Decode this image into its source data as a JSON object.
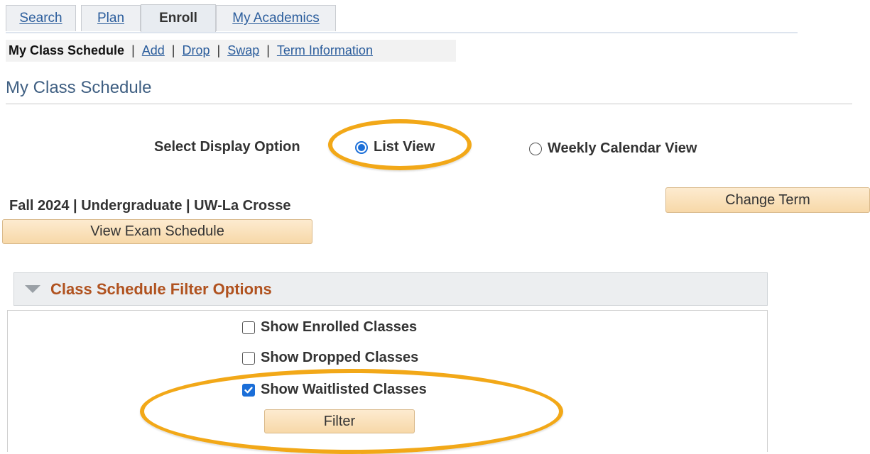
{
  "tabs": [
    {
      "label": "Search"
    },
    {
      "label": "Plan"
    },
    {
      "label": "Enroll"
    },
    {
      "label": "My Academics"
    }
  ],
  "subnav": {
    "current": "My Class Schedule",
    "links": [
      "Add",
      "Drop",
      "Swap",
      "Term Information"
    ]
  },
  "page_title": "My Class Schedule",
  "display_option": {
    "label": "Select Display Option",
    "options": [
      "List View",
      "Weekly Calendar View"
    ],
    "selected": "List View"
  },
  "term_line": "Fall 2024 | Undergraduate | UW-La Crosse",
  "buttons": {
    "change_term": "Change Term",
    "view_exam_schedule": "View Exam Schedule",
    "filter": "Filter"
  },
  "filter_options": {
    "title": "Class Schedule Filter Options",
    "items": [
      {
        "label": "Show Enrolled Classes",
        "checked": false
      },
      {
        "label": "Show Dropped Classes",
        "checked": false
      },
      {
        "label": "Show Waitlisted Classes",
        "checked": true
      }
    ]
  },
  "colors": {
    "accent": "#1a6ed8",
    "highlight": "#f2a818",
    "group_title": "#b0521f",
    "link": "#2b5d9c"
  }
}
